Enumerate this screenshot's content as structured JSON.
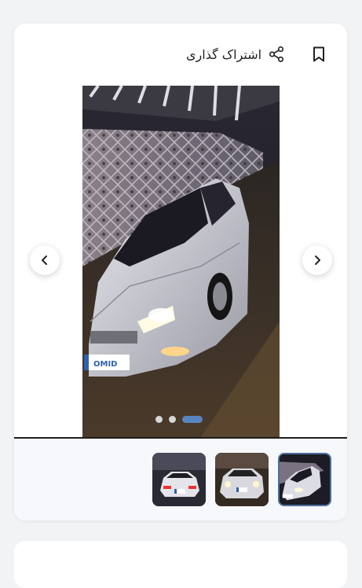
{
  "header": {
    "share_label": "اشتراک گذاری"
  },
  "icons": {
    "bookmark": "bookmark-icon",
    "share": "share-icon",
    "prev": "chevron-left-icon",
    "next": "chevron-right-icon"
  },
  "gallery": {
    "plate_logo": "OMID",
    "dots_count": 3,
    "active_dot": 3,
    "thumbnail_count": 3,
    "selected_thumbnail": 1
  },
  "colors": {
    "accent": "#5a84c0",
    "selected_border": "#4a6f9b"
  }
}
